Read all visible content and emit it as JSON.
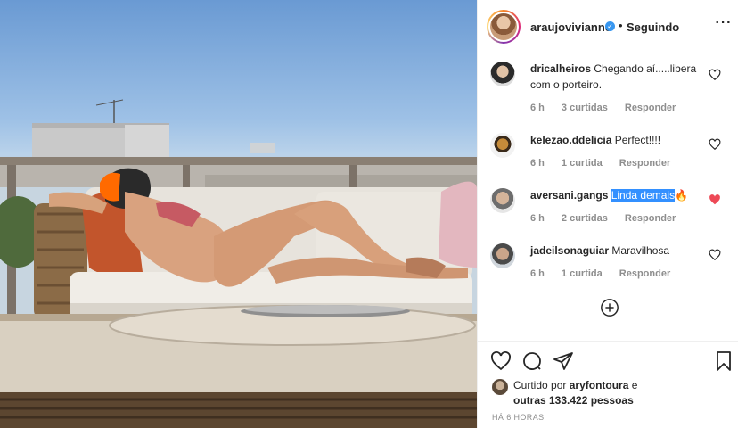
{
  "header": {
    "username": "araujovivianne",
    "verified_symbol": "✓",
    "separator": "•",
    "follow_status": "Seguindo",
    "more_symbol": "···"
  },
  "comments": [
    {
      "user": "dricalheiros",
      "text": "Chegando aí.....libera com o porteiro.",
      "time": "6 h",
      "likes": "3 curtidas",
      "reply": "Responder",
      "liked": false
    },
    {
      "user": "kelezao.ddelicia",
      "text": "Perfect!!!!",
      "time": "6 h",
      "likes": "1 curtida",
      "reply": "Responder",
      "liked": false
    },
    {
      "user": "aversani.gangs",
      "text": "Linda demais",
      "emoji": "🔥",
      "time": "6 h",
      "likes": "2 curtidas",
      "reply": "Responder",
      "liked": true
    },
    {
      "user": "jadeilsonaguiar",
      "text": "Maravilhosa",
      "time": "6 h",
      "likes": "1 curtida",
      "reply": "Responder",
      "liked": false
    }
  ],
  "likes": {
    "prefix": "Curtido por",
    "user": "aryfontoura",
    "middle": "e",
    "others": "outras 133.422 pessoas"
  },
  "timestamp": "HÁ 6 HORAS",
  "colors": {
    "accent": "#3897f0",
    "heart_liked": "#ed4956",
    "muted": "#8e8e8e"
  },
  "icons": [
    "heart-icon",
    "comment-icon",
    "share-icon",
    "bookmark-icon",
    "plus-circle-icon",
    "more-icon",
    "verified-icon"
  ]
}
